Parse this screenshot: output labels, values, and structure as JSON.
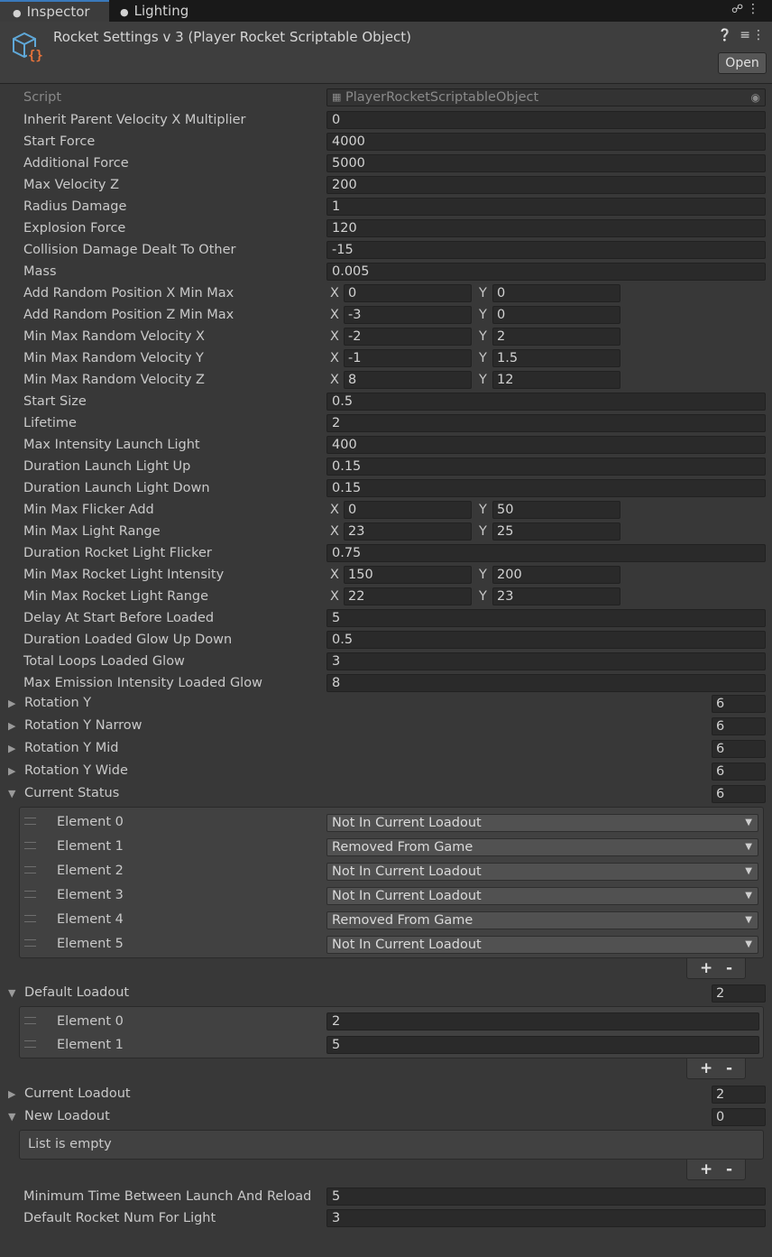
{
  "tabs": [
    {
      "label": "Inspector",
      "icon": "info-icon"
    },
    {
      "label": "Lighting",
      "icon": "lightbulb-icon"
    }
  ],
  "header": {
    "title": "Rocket Settings v 3 (Player Rocket Scriptable Object)",
    "open_label": "Open"
  },
  "script": {
    "label": "Script",
    "value": "PlayerRocketScriptableObject"
  },
  "fields": [
    {
      "label": "Inherit Parent Velocity X Multiplier",
      "value": "0"
    },
    {
      "label": "Start Force",
      "value": "4000"
    },
    {
      "label": "Additional Force",
      "value": "5000"
    },
    {
      "label": "Max Velocity Z",
      "value": "200"
    },
    {
      "label": "Radius Damage",
      "value": "1"
    },
    {
      "label": "Explosion Force",
      "value": "120"
    },
    {
      "label": "Collision Damage Dealt To Other",
      "value": "-15"
    },
    {
      "label": "Mass",
      "value": "0.005"
    },
    {
      "label": "Add Random Position X Min Max",
      "x": "0",
      "y": "0"
    },
    {
      "label": "Add Random Position Z Min Max",
      "x": "-3",
      "y": "0"
    },
    {
      "label": "Min Max Random Velocity X",
      "x": "-2",
      "y": "2"
    },
    {
      "label": "Min Max Random Velocity Y",
      "x": "-1",
      "y": "1.5"
    },
    {
      "label": "Min Max Random Velocity Z",
      "x": "8",
      "y": "12"
    },
    {
      "label": "Start Size",
      "value": "0.5"
    },
    {
      "label": "Lifetime",
      "value": "2"
    },
    {
      "label": "Max Intensity Launch Light",
      "value": "400"
    },
    {
      "label": "Duration Launch Light Up",
      "value": "0.15"
    },
    {
      "label": "Duration Launch Light Down",
      "value": "0.15"
    },
    {
      "label": "Min Max Flicker Add",
      "x": "0",
      "y": "50"
    },
    {
      "label": "Min Max Light Range",
      "x": "23",
      "y": "25"
    },
    {
      "label": "Duration Rocket Light Flicker",
      "value": "0.75"
    },
    {
      "label": "Min Max Rocket Light Intensity",
      "x": "150",
      "y": "200"
    },
    {
      "label": "Min Max Rocket Light Range",
      "x": "22",
      "y": "23"
    },
    {
      "label": "Delay At Start Before Loaded",
      "value": "5"
    },
    {
      "label": "Duration Loaded Glow Up Down",
      "value": "0.5"
    },
    {
      "label": "Total Loops Loaded Glow",
      "value": "3"
    },
    {
      "label": "Max Emission Intensity Loaded Glow",
      "value": "8"
    }
  ],
  "xy_labels": {
    "x": "X",
    "y": "Y"
  },
  "collapsed_lists": [
    {
      "label": "Rotation Y",
      "count": "6"
    },
    {
      "label": "Rotation Y Narrow",
      "count": "6"
    },
    {
      "label": "Rotation Y Mid",
      "count": "6"
    },
    {
      "label": "Rotation Y Wide",
      "count": "6"
    }
  ],
  "current_status": {
    "label": "Current Status",
    "count": "6",
    "elements": [
      {
        "label": "Element 0",
        "value": "Not In Current Loadout"
      },
      {
        "label": "Element 1",
        "value": "Removed From Game"
      },
      {
        "label": "Element 2",
        "value": "Not In Current Loadout"
      },
      {
        "label": "Element 3",
        "value": "Not In Current Loadout"
      },
      {
        "label": "Element 4",
        "value": "Removed From Game"
      },
      {
        "label": "Element 5",
        "value": "Not In Current Loadout"
      }
    ]
  },
  "default_loadout": {
    "label": "Default Loadout",
    "count": "2",
    "elements": [
      {
        "label": "Element 0",
        "value": "2"
      },
      {
        "label": "Element 1",
        "value": "5"
      }
    ]
  },
  "current_loadout": {
    "label": "Current Loadout",
    "count": "2"
  },
  "new_loadout": {
    "label": "New Loadout",
    "count": "0",
    "empty_text": "List is empty"
  },
  "footer_fields": [
    {
      "label": "Minimum Time Between Launch And Reload",
      "value": "5"
    },
    {
      "label": "Default Rocket Num For Light",
      "value": "3"
    }
  ],
  "plus": "+",
  "minus": "-",
  "colors": {
    "accent": "#3a79bb",
    "icon_blue": "#5fa8d8",
    "icon_orange": "#e8733a"
  }
}
